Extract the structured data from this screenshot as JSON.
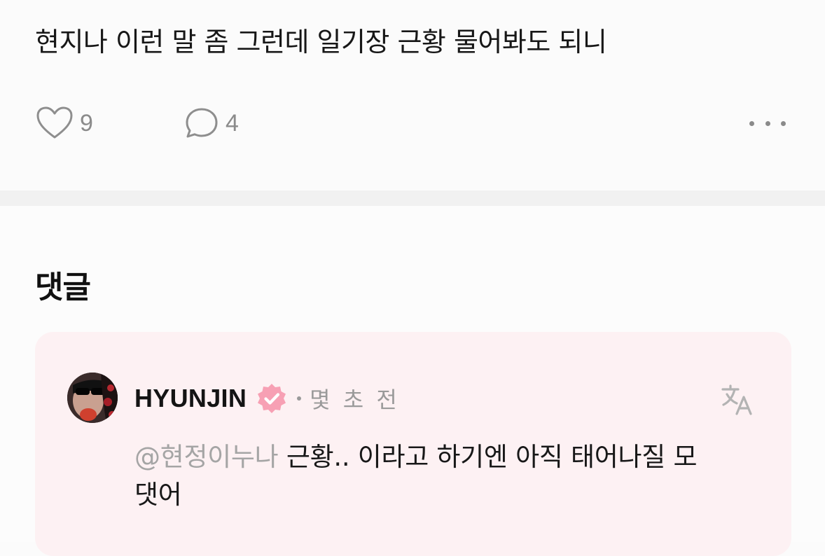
{
  "post": {
    "text": "현지나 이런 말 좀 그런데 일기장 근황 물어봐도 되니",
    "like_icon": "heart-outline-icon",
    "like_count": "9",
    "comment_icon": "speech-bubble-icon",
    "comment_count": "4",
    "more_icon": "more-horizontal-icon"
  },
  "comments": {
    "title": "댓글",
    "items": [
      {
        "author": "HYUNJIN",
        "verified_icon": "verified-badge-icon",
        "time": "몇 초 전",
        "translate_icon": "translate-icon",
        "mention": "@현정이누나",
        "text_line1": "근황.. 이라고 하기엔 아직 태어나질 모",
        "text_line2": "댓어"
      }
    ]
  },
  "colors": {
    "background": "#fbfbfb",
    "divider": "#f1f1f1",
    "comment_card": "#fdf1f3",
    "badge_pink": "#f7a0b4",
    "muted": "#9a9a9a"
  }
}
